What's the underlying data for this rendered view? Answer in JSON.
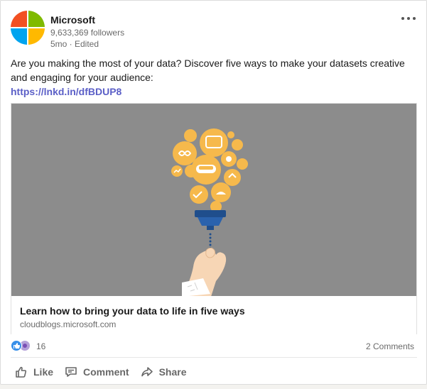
{
  "post": {
    "author": {
      "name": "Microsoft",
      "followers": "9,633,369 followers",
      "meta": "5mo · Edited"
    },
    "text": "Are you making the most of your data? Discover five ways to make your datasets creative and engaging for your audience:",
    "link_text": "https://lnkd.in/dfBDUP8",
    "preview": {
      "title": "Learn how to bring your data to life in five ways",
      "domain": "cloudblogs.microsoft.com"
    },
    "reactions_count": "16",
    "comments_count": "2 Comments",
    "actions": {
      "like": "Like",
      "comment": "Comment",
      "share": "Share"
    }
  },
  "icons": {
    "more": "more-horizontal-icon",
    "like": "thumbs-up-icon",
    "comment": "comment-icon",
    "share": "share-arrow-icon"
  },
  "colors": {
    "link": "#5b5fc7",
    "preview_bg": "#8c8c8c",
    "bubble": "#f6b94c",
    "funnel": "#1f4e8c",
    "reaction_like": "#378fe9"
  }
}
